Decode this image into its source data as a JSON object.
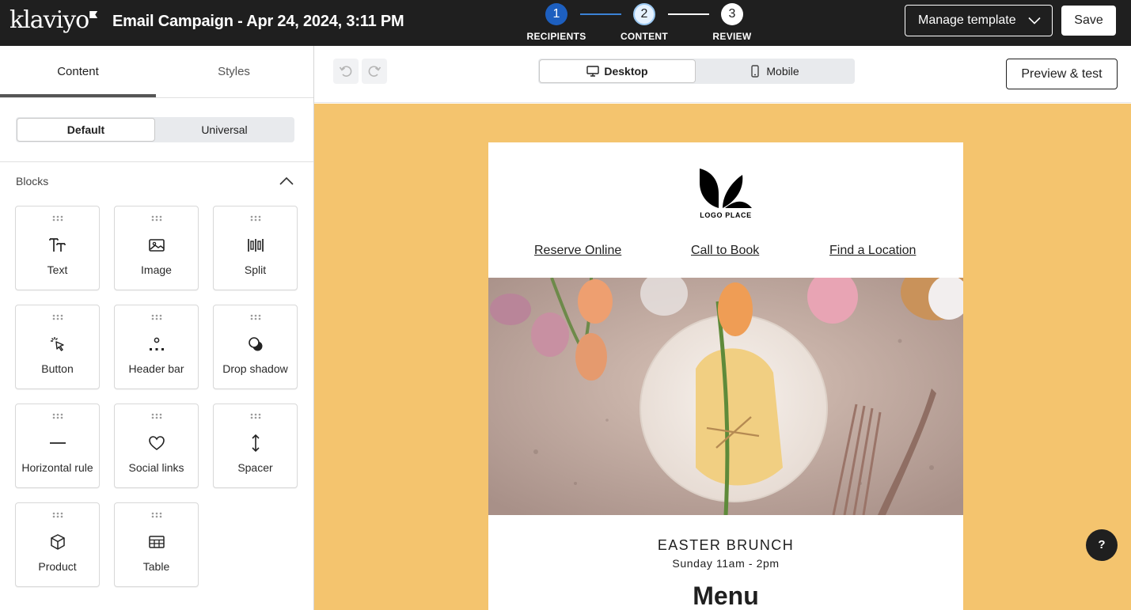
{
  "header": {
    "brand": "klaviyo",
    "campaign_title": "Email Campaign - Apr 24, 2024, 3:11 PM",
    "steps": [
      {
        "number": "1",
        "label": "RECIPIENTS"
      },
      {
        "number": "2",
        "label": "CONTENT"
      },
      {
        "number": "3",
        "label": "REVIEW"
      }
    ],
    "manage_template_label": "Manage template",
    "save_label": "Save"
  },
  "sidebar": {
    "tabs": [
      {
        "label": "Content",
        "active": true
      },
      {
        "label": "Styles",
        "active": false
      }
    ],
    "segment": [
      {
        "label": "Default",
        "active": true
      },
      {
        "label": "Universal",
        "active": false
      }
    ],
    "blocks_title": "Blocks",
    "blocks": [
      {
        "label": "Text",
        "icon": "text-icon"
      },
      {
        "label": "Image",
        "icon": "image-icon"
      },
      {
        "label": "Split",
        "icon": "split-icon"
      },
      {
        "label": "Button",
        "icon": "button-icon"
      },
      {
        "label": "Header bar",
        "icon": "header-bar-icon"
      },
      {
        "label": "Drop shadow",
        "icon": "drop-shadow-icon"
      },
      {
        "label": "Horizontal rule",
        "icon": "horizontal-rule-icon"
      },
      {
        "label": "Social links",
        "icon": "heart-icon"
      },
      {
        "label": "Spacer",
        "icon": "spacer-icon"
      },
      {
        "label": "Product",
        "icon": "product-icon"
      },
      {
        "label": "Table",
        "icon": "table-icon"
      }
    ]
  },
  "toolbar": {
    "device_options": [
      {
        "label": "Desktop",
        "active": true
      },
      {
        "label": "Mobile",
        "active": false
      }
    ],
    "preview_label": "Preview & test"
  },
  "email": {
    "logo_text": "LOGO PLACE",
    "nav_links": [
      "Reserve Online",
      "Call to Book",
      "Find a Location"
    ],
    "event_title": "EASTER BRUNCH",
    "event_time": "Sunday 11am - 2pm",
    "menu_heading": "Menu"
  },
  "help_label": "?",
  "colors": {
    "topbar": "#1f1f1f",
    "active_step": "#1d5fbf",
    "canvas_background": "#f4c46e",
    "hero_background": "#c9b2a7"
  }
}
